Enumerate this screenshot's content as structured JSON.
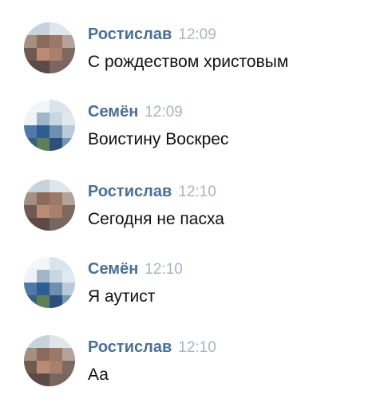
{
  "messages": [
    {
      "author": "Ростислав",
      "time": "12:09",
      "text": "С рождеством христовым",
      "avatar": "avatar-rostislav"
    },
    {
      "author": "Семён",
      "time": "12:09",
      "text": "Воистину Воскрес",
      "avatar": "avatar-semyon"
    },
    {
      "author": "Ростислав",
      "time": "12:10",
      "text": "Сегодня не пасха",
      "avatar": "avatar-rostislav"
    },
    {
      "author": "Семён",
      "time": "12:10",
      "text": "Я аутист",
      "avatar": "avatar-semyon"
    },
    {
      "author": "Ростислав",
      "time": "12:10",
      "text": "Аа",
      "avatar": "avatar-rostislav"
    }
  ],
  "colors": {
    "author": "#4a6f96",
    "time": "#a8b5c3",
    "text": "#111111",
    "background": "#ffffff"
  }
}
